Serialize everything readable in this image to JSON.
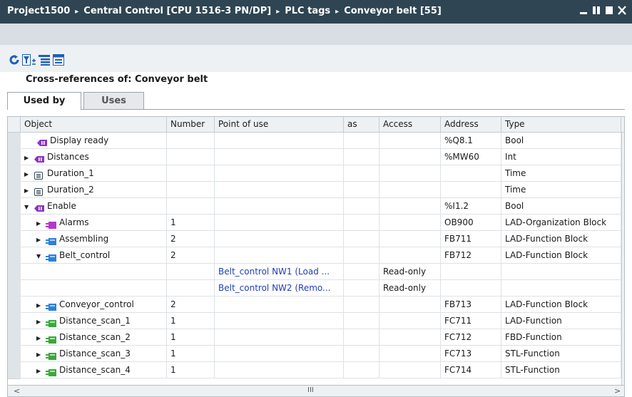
{
  "titlebar": {
    "breadcrumbs": [
      "Project1500",
      "Central Control [CPU 1516-3 PN/DP]",
      "PLC tags",
      "Conveyor belt [55]"
    ],
    "separator": "▸"
  },
  "toolbar": {
    "icons": [
      "refresh-icon",
      "filter-icon",
      "expand-all-icon",
      "collapse-all-icon"
    ]
  },
  "panel": {
    "title": "Cross-references of: Conveyor belt"
  },
  "tabs": [
    {
      "label": "Used by",
      "active": true
    },
    {
      "label": "Uses",
      "active": false
    }
  ],
  "columns": [
    "Object",
    "Number",
    "Point of use",
    "as",
    "Access",
    "Address",
    "Type"
  ],
  "rows": [
    {
      "level": 1,
      "expand": "none",
      "icon": "tag",
      "object": "Display ready",
      "number": "",
      "point": "",
      "as": "",
      "access": "",
      "address": "%Q8.1",
      "type": "Bool"
    },
    {
      "level": 0,
      "expand": "collapsed",
      "icon": "tag",
      "object": "Distances",
      "number": "",
      "point": "",
      "as": "",
      "access": "",
      "address": "%MW60",
      "type": "Int"
    },
    {
      "level": 0,
      "expand": "collapsed",
      "icon": "list",
      "object": "Duration_1",
      "number": "",
      "point": "",
      "as": "",
      "access": "",
      "address": "",
      "type": "Time"
    },
    {
      "level": 0,
      "expand": "collapsed",
      "icon": "list",
      "object": "Duration_2",
      "number": "",
      "point": "",
      "as": "",
      "access": "",
      "address": "",
      "type": "Time"
    },
    {
      "level": 0,
      "expand": "expanded",
      "icon": "tag",
      "object": "Enable",
      "number": "",
      "point": "",
      "as": "",
      "access": "",
      "address": "%I1.2",
      "type": "Bool"
    },
    {
      "level": 1,
      "expand": "collapsed",
      "icon": "ob",
      "object": "Alarms",
      "number": "1",
      "point": "",
      "as": "",
      "access": "",
      "address": "OB900",
      "type": "LAD-Organization Block"
    },
    {
      "level": 1,
      "expand": "collapsed",
      "icon": "fb",
      "object": "Assembling",
      "number": "2",
      "point": "",
      "as": "",
      "access": "",
      "address": "FB711",
      "type": "LAD-Function Block"
    },
    {
      "level": 1,
      "expand": "expanded",
      "icon": "fb",
      "object": "Belt_control",
      "number": "2",
      "point": "",
      "as": "",
      "access": "",
      "address": "FB712",
      "type": "LAD-Function Block"
    },
    {
      "level": 2,
      "expand": "none",
      "icon": "none",
      "object": "",
      "number": "",
      "point": "Belt_control NW1 (Load ...",
      "as": "",
      "access": "Read-only",
      "address": "",
      "type": ""
    },
    {
      "level": 2,
      "expand": "none",
      "icon": "none",
      "object": "",
      "number": "",
      "point": "Belt_control NW2 (Remo...",
      "as": "",
      "access": "Read-only",
      "address": "",
      "type": ""
    },
    {
      "level": 1,
      "expand": "collapsed",
      "icon": "fb",
      "object": "Conveyor_control",
      "number": "2",
      "point": "",
      "as": "",
      "access": "",
      "address": "FB713",
      "type": "LAD-Function Block"
    },
    {
      "level": 1,
      "expand": "collapsed",
      "icon": "fc",
      "object": "Distance_scan_1",
      "number": "1",
      "point": "",
      "as": "",
      "access": "",
      "address": "FC711",
      "type": "LAD-Function"
    },
    {
      "level": 1,
      "expand": "collapsed",
      "icon": "fc",
      "object": "Distance_scan_2",
      "number": "1",
      "point": "",
      "as": "",
      "access": "",
      "address": "FC712",
      "type": "FBD-Function"
    },
    {
      "level": 1,
      "expand": "collapsed",
      "icon": "fc",
      "object": "Distance_scan_3",
      "number": "1",
      "point": "",
      "as": "",
      "access": "",
      "address": "FC713",
      "type": "STL-Function"
    },
    {
      "level": 1,
      "expand": "collapsed",
      "icon": "fc",
      "object": "Distance_scan_4",
      "number": "1",
      "point": "",
      "as": "",
      "access": "",
      "address": "FC714",
      "type": "STL-Function"
    }
  ],
  "colors": {
    "titlebar": "#2f4553",
    "link": "#1f3fb8",
    "fb_icon": "#2f7fd8",
    "fc_icon": "#3aa83a",
    "ob_icon": "#b03ac8",
    "tag_icon": "#8a36c4"
  }
}
